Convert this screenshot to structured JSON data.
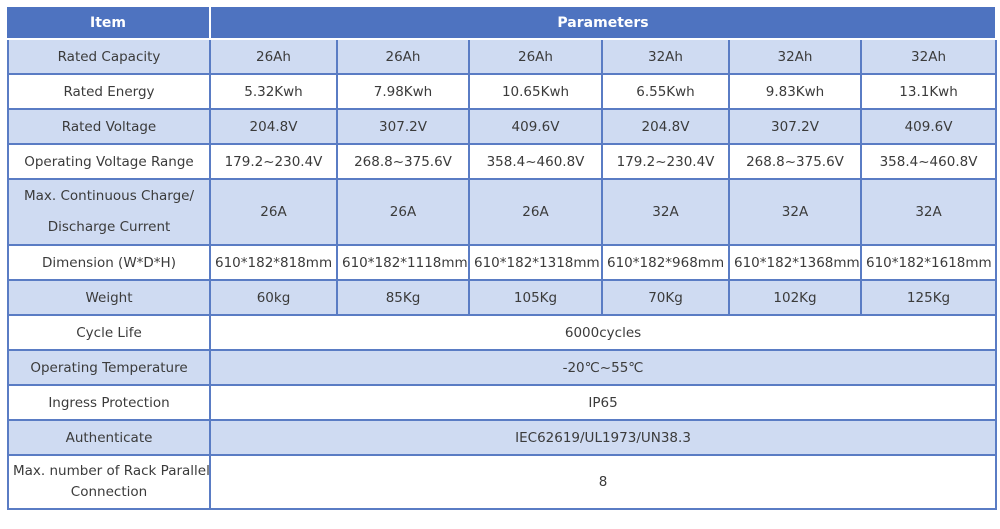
{
  "header": {
    "item": "Item",
    "parameters": "Parameters"
  },
  "rows": [
    {
      "label": "Rated Capacity",
      "values": [
        "26Ah",
        "26Ah",
        "26Ah",
        "32Ah",
        "32Ah",
        "32Ah"
      ]
    },
    {
      "label": "Rated Energy",
      "values": [
        "5.32Kwh",
        "7.98Kwh",
        "10.65Kwh",
        "6.55Kwh",
        "9.83Kwh",
        "13.1Kwh"
      ]
    },
    {
      "label": "Rated Voltage",
      "values": [
        "204.8V",
        "307.2V",
        "409.6V",
        "204.8V",
        "307.2V",
        "409.6V"
      ]
    },
    {
      "label": "Operating Voltage Range",
      "values": [
        "179.2~230.4V",
        "268.8~375.6V",
        "358.4~460.8V",
        "179.2~230.4V",
        "268.8~375.6V",
        "358.4~460.8V"
      ]
    },
    {
      "label_line1": "Max. Continuous Charge/",
      "label_line2": "Discharge Current",
      "values": [
        "26A",
        "26A",
        "26A",
        "32A",
        "32A",
        "32A"
      ]
    },
    {
      "label": "Dimension (W*D*H)",
      "values": [
        "610*182*818mm",
        "610*182*1118mm",
        "610*182*1318mm",
        "610*182*968mm",
        "610*182*1368mm",
        "610*182*1618mm"
      ]
    },
    {
      "label": "Weight",
      "values": [
        "60kg",
        "85Kg",
        "105Kg",
        "70Kg",
        "102Kg",
        "125Kg"
      ]
    },
    {
      "label": "Cycle Life",
      "value": "6000cycles"
    },
    {
      "label": "Operating Temperature",
      "value": "-20℃~55℃"
    },
    {
      "label": "Ingress Protection",
      "value": "IP65"
    },
    {
      "label": "Authenticate",
      "value": "IEC62619/UL1973/UN38.3"
    },
    {
      "label_line1": "Max. number of Rack Parallel",
      "label_line2": "Connection",
      "value": "8"
    }
  ]
}
